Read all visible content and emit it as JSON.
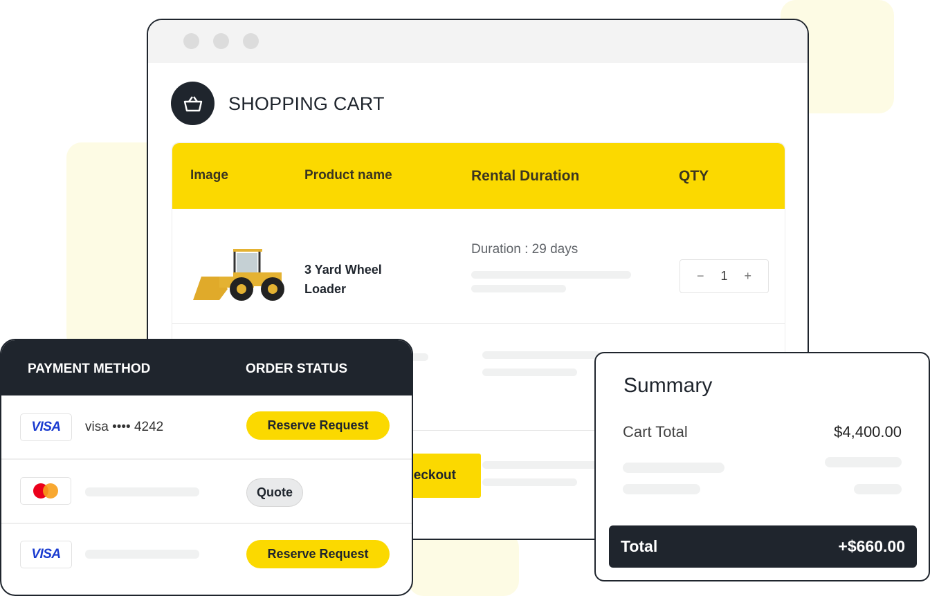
{
  "cart": {
    "title": "SHOPPING CART",
    "columns": [
      "Image",
      "Product name",
      "Rental Duration",
      "QTY"
    ],
    "item": {
      "name_line1": "3 Yard Wheel",
      "name_line2": "Loader",
      "duration": "Duration : 29 days",
      "qty": "1"
    },
    "checkout_label": "Checkout"
  },
  "payments": {
    "headers": [
      "PAYMENT METHOD",
      "ORDER STATUS"
    ],
    "rows": [
      {
        "card": "VISA",
        "number": "visa •••• 4242",
        "status": "Reserve Request"
      },
      {
        "card": "mastercard",
        "status": "Quote"
      },
      {
        "card": "VISA",
        "status": "Reserve Request"
      }
    ]
  },
  "summary": {
    "title": "Summary",
    "cart_total_label": "Cart Total",
    "cart_total": "$4,400.00",
    "total_label": "Total",
    "total": "+$660.00"
  },
  "colors": {
    "accent": "#FBD900",
    "dark": "#1F252D"
  }
}
